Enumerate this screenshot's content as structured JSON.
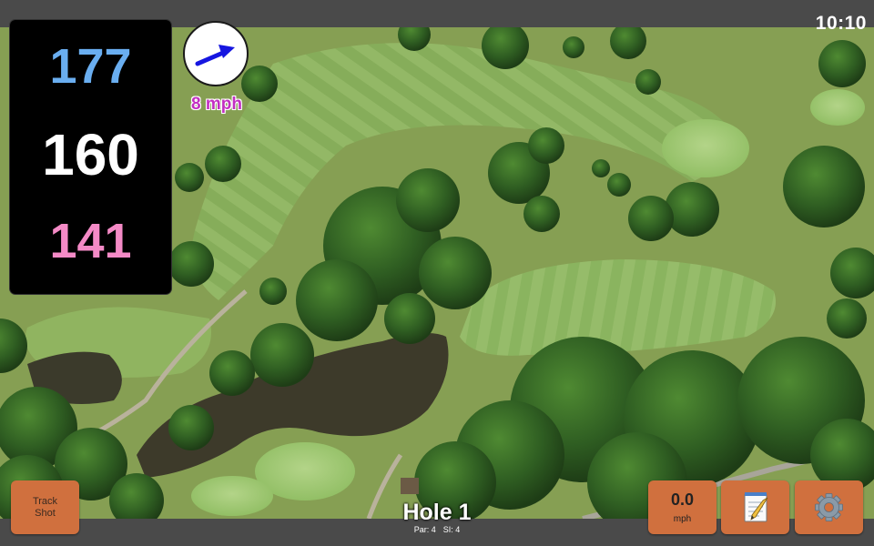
{
  "status_bar": {
    "time": "10:10"
  },
  "distances": {
    "back": "177",
    "middle": "160",
    "front": "141",
    "colors": {
      "back": "#6aaef0",
      "middle": "#ffffff",
      "front": "#f48ac6"
    }
  },
  "wind": {
    "speed_label": "8 mph",
    "arrow_color": "#1616e0",
    "speed_color": "#c22fc2",
    "icon": "wind-direction-arrow"
  },
  "buttons": {
    "track_shot_line1": "Track",
    "track_shot_line2": "Shot",
    "speed_value": "0.0",
    "speed_unit": "mph",
    "notes_icon": "notepad-icon",
    "settings_icon": "gear-icon",
    "accent": "#d0703e"
  },
  "hole": {
    "title": "Hole 1",
    "par_label": "Par: 4",
    "si_label": "SI: 4"
  }
}
